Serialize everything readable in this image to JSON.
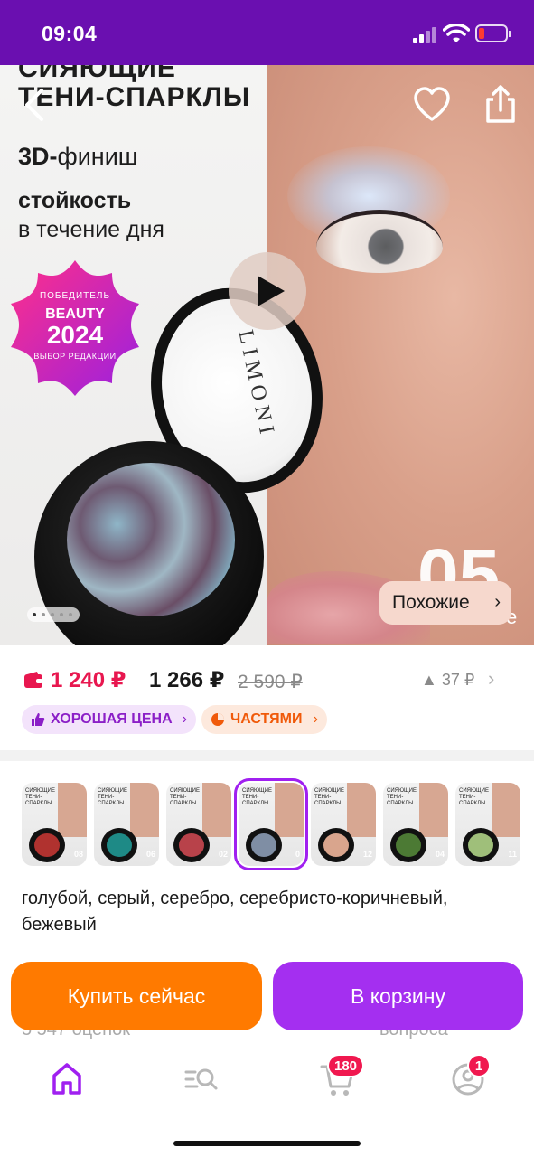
{
  "status_bar": {
    "time": "09:04"
  },
  "hero": {
    "title_line1": "СИЯЮЩИЕ",
    "title_line2": "ТЕНИ-СПАРКЛЫ",
    "finish_bold": "3D-",
    "finish_rest": "финиш",
    "durable_bold": "стойкость",
    "durable_rest": "в течение дня",
    "award_top": "ПОБЕДИТЕЛЬ",
    "award_brand": "BEAUTY",
    "award_year": "2024",
    "award_sub": "ВЫБОР РЕДАКЦИИ",
    "compact_logo": "LIMONI",
    "shade_number": "05",
    "shade_suffix": "e",
    "similar_label": "Похожие",
    "gallery_dots": 5,
    "gallery_active_index": 0
  },
  "price": {
    "card_price": "1 240 ₽",
    "price": "1 266 ₽",
    "old_price": "2 590 ₽",
    "delta": "37 ₽"
  },
  "badges": {
    "good_price": "ХОРОШАЯ ЦЕНА",
    "installments": "ЧАСТЯМИ"
  },
  "variants": {
    "items": [
      {
        "shade": "08",
        "color": "#b0322f"
      },
      {
        "shade": "06",
        "color": "#1e8a86"
      },
      {
        "shade": "02",
        "color": "#b8424a"
      },
      {
        "shade": "0",
        "color": "#7f8ea4"
      },
      {
        "shade": "12",
        "color": "#d9a58d"
      },
      {
        "shade": "04",
        "color": "#4c7a34"
      },
      {
        "shade": "11",
        "color": "#9fbf7a"
      }
    ],
    "thumb_brand": "LIMONI",
    "thumb_title": "СИЯЮЩИЕ ТЕНИ-СПАРКЛЫ",
    "selected_index": 3,
    "description": "голубой, серый, серебро, серебристо-коричневый, бежевый"
  },
  "behind": {
    "reviews": "5 547 оценок",
    "questions": "вопроса"
  },
  "buy_bar": {
    "buy_now": "Купить сейчас",
    "add_to_cart": "В корзину"
  },
  "bottom_nav": {
    "cart_badge": "180",
    "profile_badge": "1"
  },
  "colors": {
    "brand_purple": "#6a0fb0",
    "accent_orange": "#ff7a00",
    "accent_violet": "#a42ff0",
    "price_red": "#e8174f"
  }
}
